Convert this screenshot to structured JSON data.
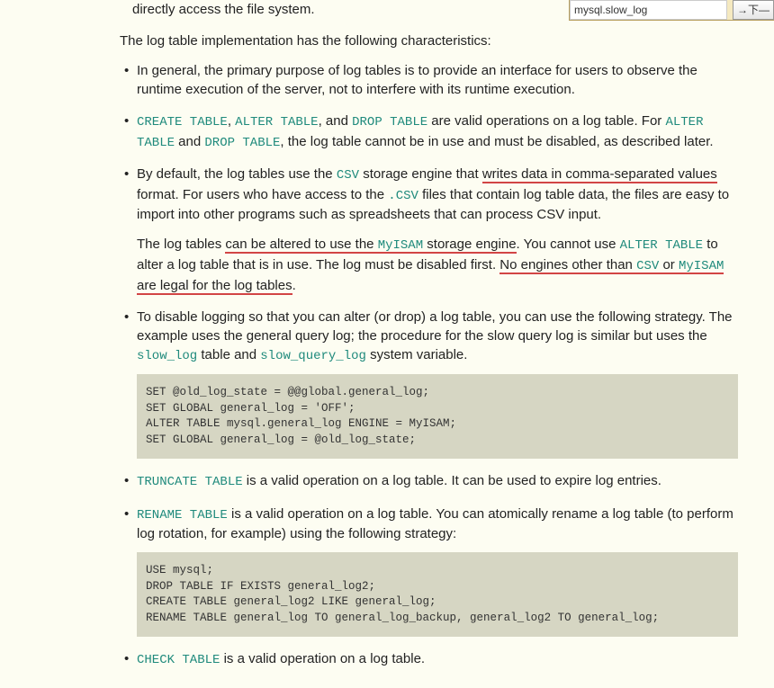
{
  "search": {
    "value": "mysql.slow_log",
    "button": "→下—"
  },
  "partial_top": "directly access the file system.",
  "intro_para": "The log table implementation has the following characteristics:",
  "b1": "In general, the primary purpose of log tables is to provide an interface for users to observe the runtime execution of the server, not to interfere with its runtime execution.",
  "b2": {
    "code_create": "CREATE TABLE",
    "sep1": ", ",
    "code_alter": "ALTER TABLE",
    "sep2": ", and ",
    "code_drop": "DROP TABLE",
    "mid": " are valid operations on a log table. For ",
    "code_alter2": "ALTER TABLE",
    "and": " and ",
    "code_drop2": "DROP TABLE",
    "tail": ", the log table cannot be in use and must be disabled, as described later."
  },
  "b3": {
    "p1_a": "By default, the log tables use the ",
    "p1_csv": "CSV",
    "p1_b": " storage engine that ",
    "p1_ul": "writes data in comma-separated values",
    "p1_c": " format. For users who have access to the ",
    "p1_csvfile": ".CSV",
    "p1_d": " files that contain log table data, the files are easy to import into other programs such as spreadsheets that can process CSV input.",
    "p2_a": "The log tables ",
    "p2_ul1a": "can be altered to use the ",
    "p2_myisam": "MyISAM",
    "p2_ul1b": " storage engine",
    "p2_b": ". You cannot use ",
    "p2_alter": "ALTER TABLE",
    "p2_c": " to alter a log table that is in use. The log must be disabled first. ",
    "p2_ul2a": "No engines other than ",
    "p2_csv2": "CSV",
    "p2_or": " or ",
    "p2_myisam2": "MyISAM",
    "p2_ul2b": " are legal for the log tables",
    "p2_d": "."
  },
  "b4": {
    "a": "To disable logging so that you can alter (or drop) a log table, you can use the following strategy. The example uses the general query log; the procedure for the slow query log is similar but uses the ",
    "slow_log": "slow_log",
    "b": " table and ",
    "slow_query_log": "slow_query_log",
    "c": " system variable.",
    "codeblock": "SET @old_log_state = @@global.general_log;\nSET GLOBAL general_log = 'OFF';\nALTER TABLE mysql.general_log ENGINE = MyISAM;\nSET GLOBAL general_log = @old_log_state;"
  },
  "b5": {
    "code": "TRUNCATE TABLE",
    "text": " is a valid operation on a log table. It can be used to expire log entries."
  },
  "b6": {
    "code": "RENAME TABLE",
    "text": " is a valid operation on a log table. You can atomically rename a log table (to perform log rotation, for example) using the following strategy:",
    "codeblock": "USE mysql;\nDROP TABLE IF EXISTS general_log2;\nCREATE TABLE general_log2 LIKE general_log;\nRENAME TABLE general_log TO general_log_backup, general_log2 TO general_log;"
  },
  "b7": {
    "code": "CHECK TABLE",
    "text": " is a valid operation on a log table."
  }
}
